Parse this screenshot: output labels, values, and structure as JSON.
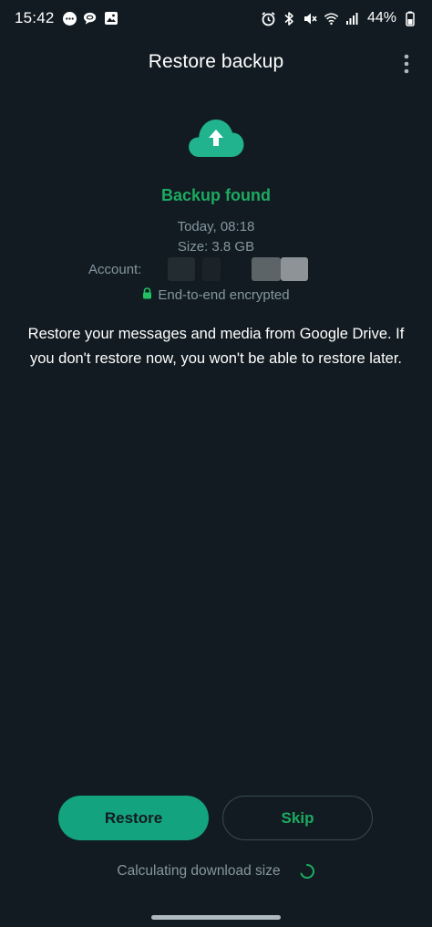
{
  "status_bar": {
    "time": "15:42",
    "battery": "44%",
    "left_icons": [
      "chat-bubble-icon",
      "messages-icon",
      "gallery-icon"
    ],
    "right_icons": [
      "alarm-icon",
      "bluetooth-icon",
      "mute-icon",
      "wifi-icon",
      "signal-icon"
    ]
  },
  "app_bar": {
    "title": "Restore backup",
    "more_icon": "more-vert-icon"
  },
  "backup": {
    "icon": "cloud-upload-icon",
    "heading": "Backup found",
    "date": "Today, 08:18",
    "size": "Size: 3.8 GB",
    "account_label": "Account:",
    "encryption_icon": "lock-icon",
    "encryption_text": "End-to-end encrypted"
  },
  "description": "Restore your messages and media from Google Drive. If you don't restore now, you won't be able to restore later.",
  "actions": {
    "restore_label": "Restore",
    "skip_label": "Skip"
  },
  "progress": {
    "text": "Calculating download size",
    "spinner_icon": "loading-spinner-icon"
  },
  "colors": {
    "background": "#111b21",
    "accent": "#1daa61",
    "button_fill": "#14a37f",
    "muted_text": "#8696a0"
  }
}
